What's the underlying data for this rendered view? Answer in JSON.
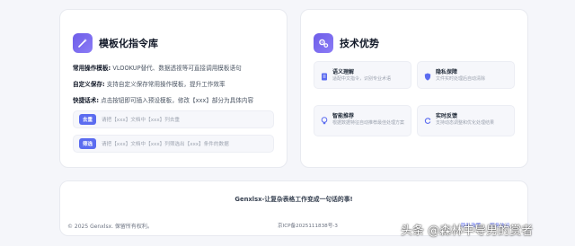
{
  "template_card": {
    "title": "模板化指令库",
    "lines": [
      {
        "label": "常用操作模板:",
        "text": "VLOOKUP替代、数据透视等可直接调用模板语句"
      },
      {
        "label": "自定义保存:",
        "text": "支持自定义保存常用操作模板，提升工作效率"
      },
      {
        "label": "快捷话术:",
        "text": "点击按钮即可插入预设模板，修改【xxx】部分为具体内容"
      }
    ],
    "commands": [
      {
        "tag": "去重",
        "text": "请把【xxx】文档中【xxx】列去重"
      },
      {
        "tag": "筛选",
        "text": "请把【xxx】文档中【xxx】列筛选出【xxx】条件的数据"
      }
    ]
  },
  "tech_card": {
    "title": "技术优势",
    "items": [
      {
        "icon": "document-icon",
        "title": "语义理解",
        "desc": "适配中文指令，识别专业术语"
      },
      {
        "icon": "shield-icon",
        "title": "隐私保障",
        "desc": "文件实时处理后自动清除"
      },
      {
        "icon": "lightbulb-icon",
        "title": "智能推荐",
        "desc": "根据数据特征自动推荐最佳处理方案"
      },
      {
        "icon": "refresh-icon",
        "title": "实时反馈",
        "desc": "支持动态调整和优化处理结果"
      }
    ]
  },
  "footer": {
    "slogan": "Genxlsx-让复杂表格工作变成一句话的事!",
    "copyright": "© 2025 Genxlsx. 保留所有权利。",
    "icp": "京ICP备2025111838号-3",
    "links": [
      "隐私政策",
      "服务协议"
    ]
  },
  "watermark": "头条 @森林中导男的赏者",
  "colors": {
    "accent": "#5b6cf0",
    "icon_gradient_start": "#6d5ce8",
    "background": "#f5f6fa"
  }
}
